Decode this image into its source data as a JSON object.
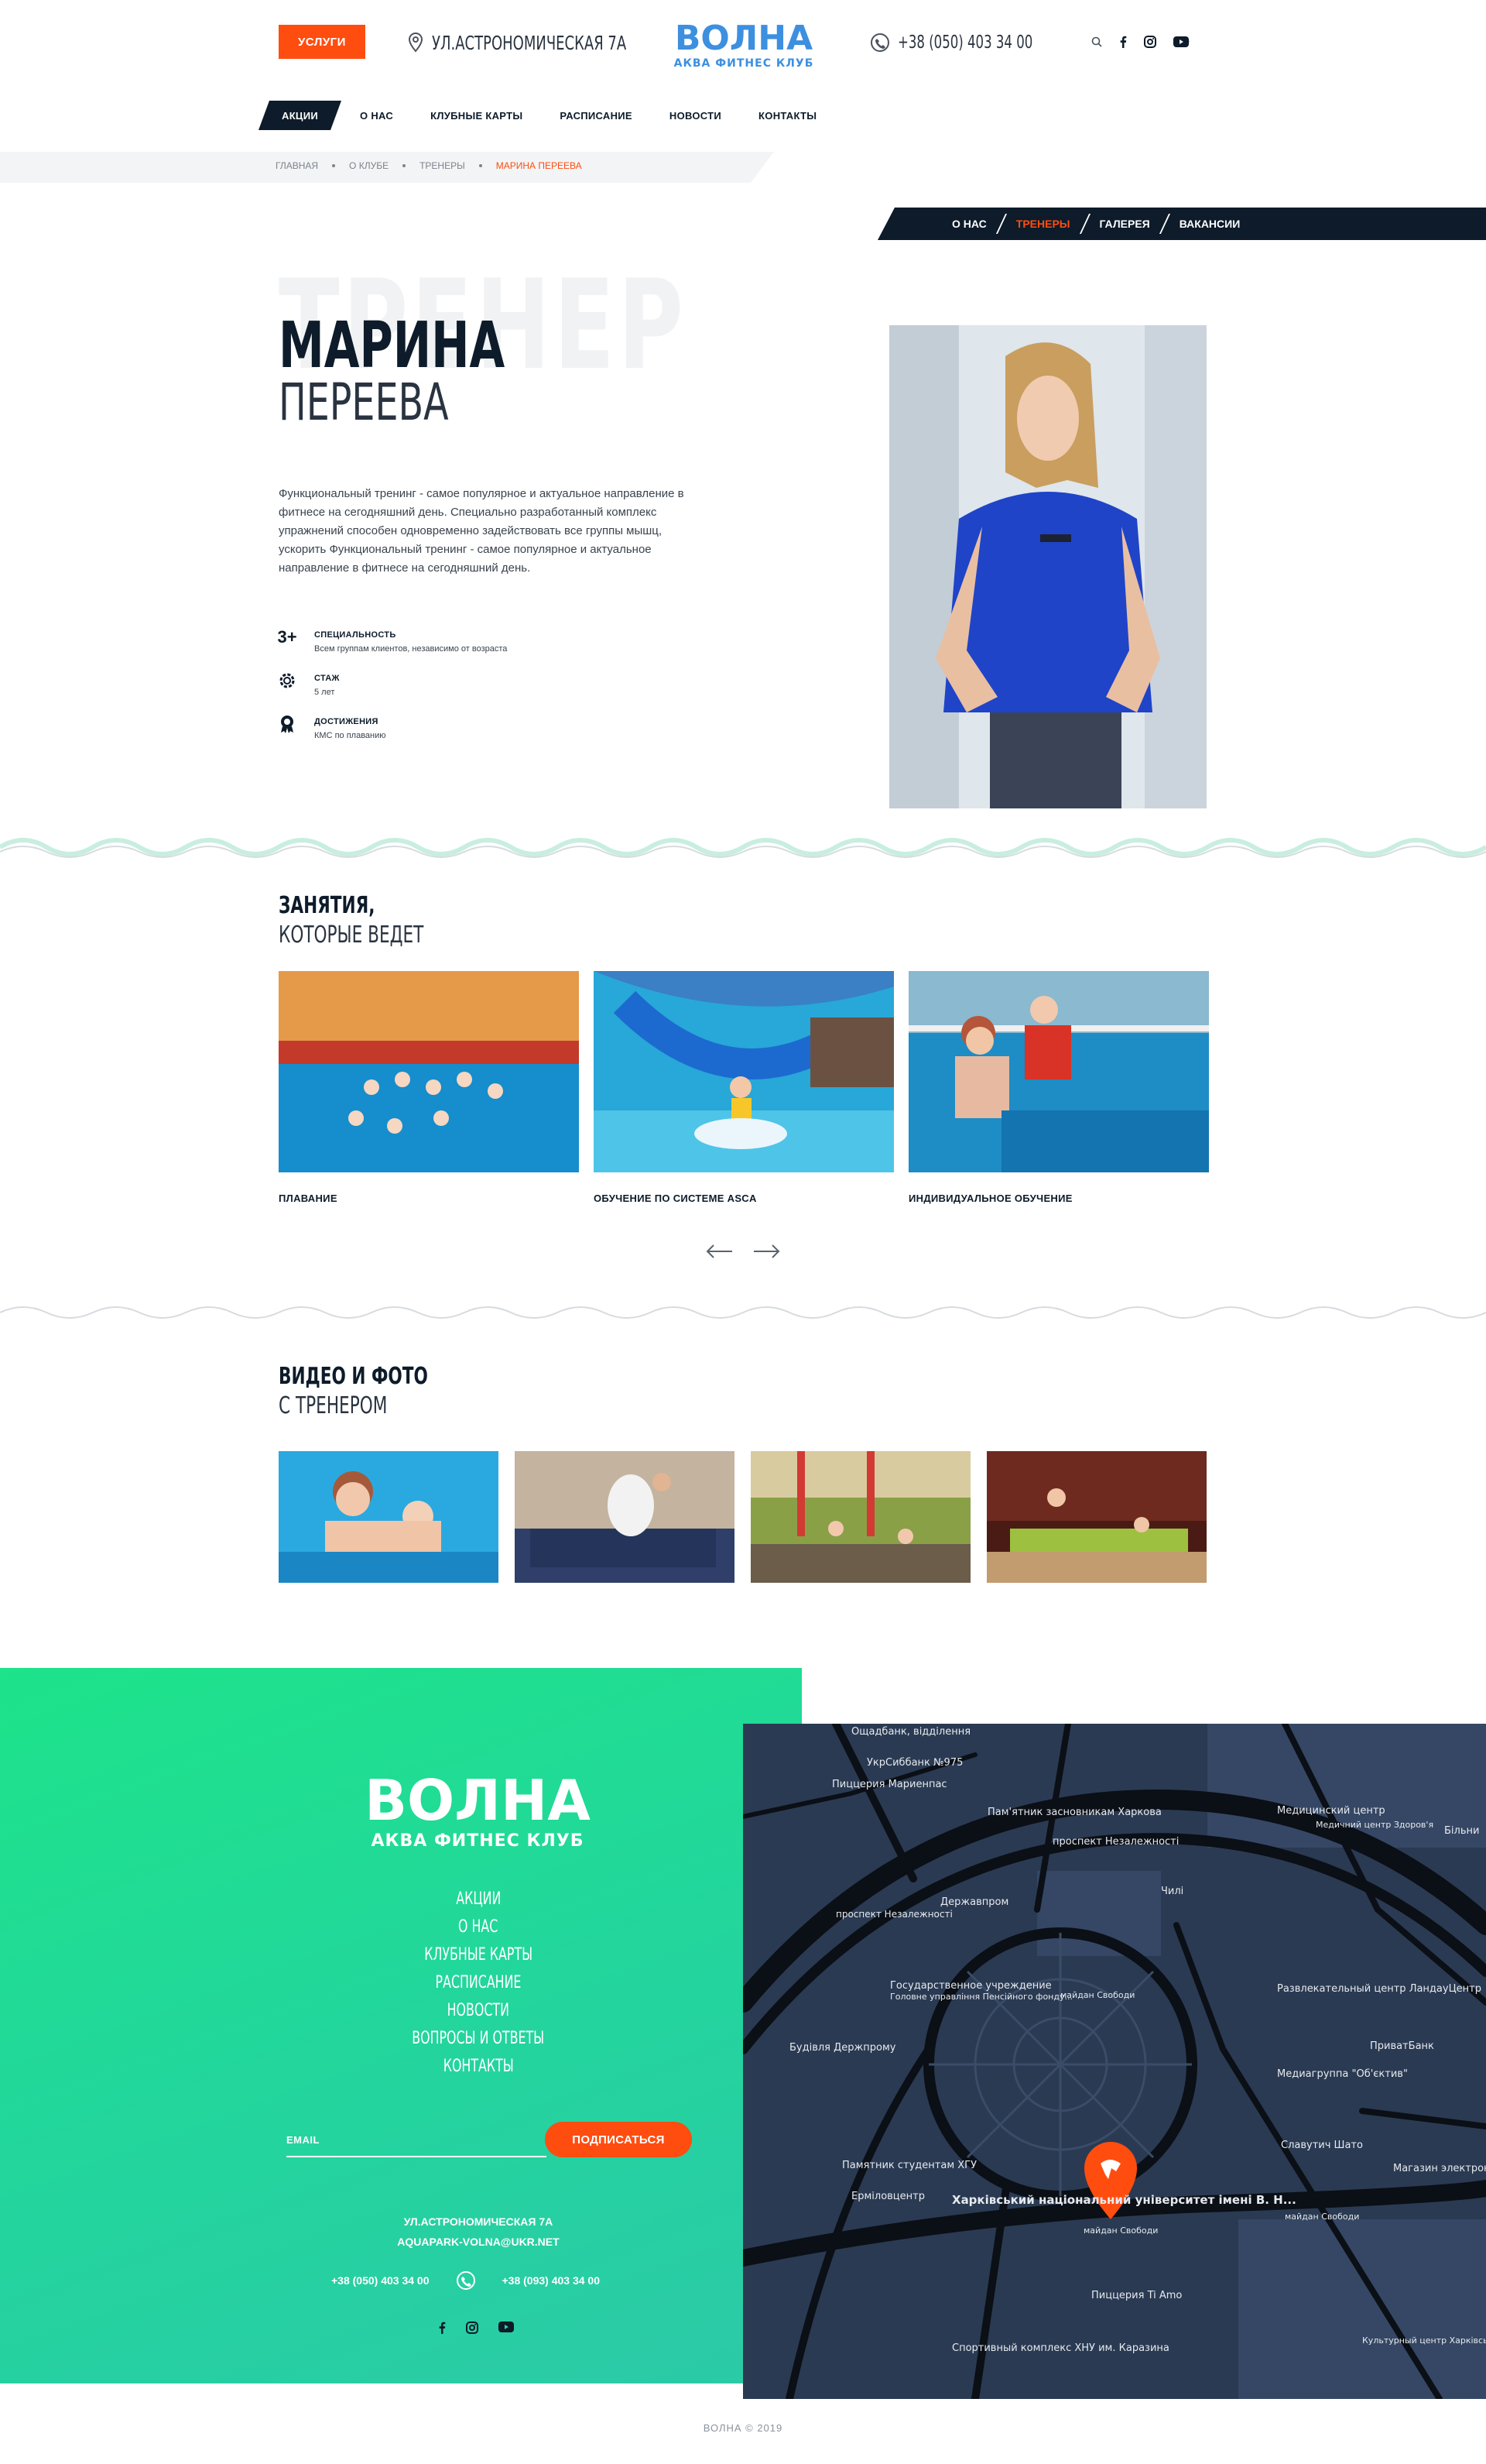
{
  "header": {
    "services_label": "УСЛУГИ",
    "address": "УЛ.АСТРОНОМИЧЕСКАЯ 7А",
    "logo_main": "ВОЛНА",
    "logo_sub": "АКВА ФИТНЕС КЛУБ",
    "phone": "+38 (050) 403 34 00",
    "icons": [
      "map-pin-icon",
      "phone-icon",
      "chevron-down-icon",
      "search-icon",
      "facebook-icon",
      "instagram-icon",
      "youtube-icon"
    ]
  },
  "nav": {
    "items": [
      {
        "label": "АКЦИИ",
        "active": true
      },
      {
        "label": "О НАС"
      },
      {
        "label": "КЛУБНЫЕ КАРТЫ"
      },
      {
        "label": "РАСПИСАНИЕ"
      },
      {
        "label": "НОВОСТИ"
      },
      {
        "label": "КОНТАКТЫ"
      }
    ]
  },
  "breadcrumb": [
    "ГЛАВНАЯ",
    "О КЛУБЕ",
    "ТРЕНЕРЫ",
    "МАРИНА ПЕРЕЕВА"
  ],
  "subnav": [
    "О НАС",
    "ТРЕНЕРЫ",
    "ГАЛЕРЕЯ",
    "ВАКАНСИИ"
  ],
  "trainer": {
    "bg_word": "ТРЕНЕР",
    "first_name": "МАРИНА",
    "last_name": "ПЕРЕЕВА",
    "description": "Функциональный тренинг - самое популярное и актуальное направление в фитнесе на сегодняшний день. Специально разработанный комплекс упражнений способен одновременно задействовать все группы мышц, ускорить  Функциональный тренинг - самое популярное и актуальное направление в фитнесе на сегодняшний день.",
    "facts": [
      {
        "icon": "3+",
        "title": "СПЕЦИАЛЬНОСТЬ",
        "value": "Всем группам клиентов, независимо от возраста"
      },
      {
        "icon": "gear-icon",
        "title": "СТАЖ",
        "value": "5 лет"
      },
      {
        "icon": "medal-icon",
        "title": "ДОСТИЖЕНИЯ",
        "value": "КМС по плаванию"
      }
    ]
  },
  "classes": {
    "title1": "ЗАНЯТИЯ,",
    "title2": "КОТОРЫЕ ВЕДЕТ",
    "items": [
      "ПЛАВАНИЕ",
      "ОБУЧЕНИЕ ПО СИСТЕМЕ ASCA",
      "ИНДИВИДУАЛЬНОЕ ОБУЧЕНИЕ"
    ]
  },
  "media": {
    "title1": "ВИДЕО И ФОТО",
    "title2": "С ТРЕНЕРОМ"
  },
  "footer": {
    "logo_main": "ВОЛНА",
    "logo_sub": "АКВА ФИТНЕС КЛУБ",
    "menu": [
      "АКЦИИ",
      "О НАС",
      "КЛУБНЫЕ КАРТЫ",
      "РАСПИСАНИЕ",
      "НОВОСТИ",
      "ВОПРОСЫ И ОТВЕТЫ",
      "КОНТАКТЫ"
    ],
    "email_placeholder": "EMAIL",
    "subscribe_label": "ПОДПИСАТЬСЯ",
    "address": "УЛ.АСТРОНОМИЧЕСКАЯ 7А",
    "email": "AQUAPARK-VOLNA@UKR.NET",
    "phone1": "+38 (050) 403 34 00",
    "phone2": "+38 (093) 403 34 00",
    "copyright": "ВОЛНА © 2019"
  },
  "map": {
    "labels": [
      "Ощадбанк, відділення",
      "УкрСиббанк №975",
      "Пиццерия Мариенпас",
      "Пам'ятник засновникам Харкова",
      "проспект Незалежності",
      "Медицинский центр",
      "Медичний центр Здоров'я",
      "Більни",
      "Державпром",
      "Чилі",
      "проспект Незалежності",
      "Государственное учреждение",
      "Головне управління Пенсійного фонду...",
      "Развлекательный центр ЛандауЦентр",
      "Будівля Держпрому",
      "майдан Свободи",
      "ПриватБанк",
      "Медиагруппа \"Об'єктив\"",
      "Памятник студентам ХГУ",
      "Славутич Шато",
      "Магазин электроники",
      "Ерміловцентр",
      "Харківський національний університет імені В. Н...",
      "майдан Свободи",
      "майдан Свободи",
      "Пиццерия Ti Amo",
      "Спортивный комплекс ХНУ им. Каразина",
      "Культурный центр Харківський обласний палац дитячо"
    ],
    "colors": {
      "bg": "#2a3a52",
      "road": "#0b0f16",
      "accent": "#ff4d10"
    }
  },
  "colors": {
    "accent": "#ff4d10",
    "navy": "#0d1b2a",
    "green": "#1de38a",
    "logo_blue": "#3d8fe0"
  }
}
